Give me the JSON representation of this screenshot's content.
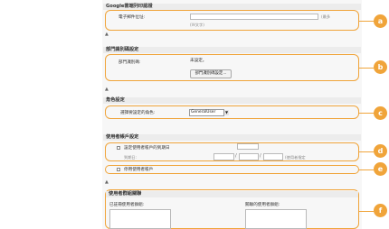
{
  "accent_color": "#f0a43a",
  "google_section": {
    "header": "Google雲端列印認證",
    "email_label": "電子郵件位址:",
    "email_value": "",
    "email_suffix": "(最多",
    "email_hint": "(Ｗ文字)"
  },
  "dept_section": {
    "header": "部門識別碼設定",
    "dept_label": "部門識別碼:",
    "dept_status": "未設定。",
    "dept_button": "部門識別碼設定..."
  },
  "role_section": {
    "header": "角色設定",
    "role_label": "選擇要設定的角色:",
    "role_value": "GeneralUser",
    "role_arrow": "▼"
  },
  "account_section": {
    "header": "使用者帳戶設定",
    "expiry_checkbox_label": "設定使用者帳戶的到期日",
    "expiry_date_label": "到期日:",
    "date_sep_1": "/",
    "date_sep_2": "/",
    "date_hint": "(使用者指定",
    "disable_checkbox_label": "停用使用者帳戶"
  },
  "group_section": {
    "header": "使用者群組關聯",
    "registered_label": "已註冊使用者群組:",
    "related_label": "關聯的使用者群組:"
  },
  "markers": {
    "section_marker": "▲",
    "a": "a",
    "b": "b",
    "c": "c",
    "d": "d",
    "e": "e",
    "f": "f"
  }
}
